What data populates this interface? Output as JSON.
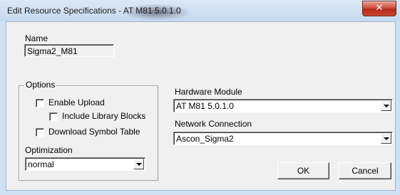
{
  "window": {
    "title": "Edit Resource Specifications - AT M81 5.0.1.0",
    "close_glyph": "✕"
  },
  "name_field": {
    "label": "Name",
    "value": "Sigma2_M81"
  },
  "options": {
    "legend": "Options",
    "enable_upload": {
      "label": "Enable Upload",
      "checked": false
    },
    "include_library_blocks": {
      "label": "Include Library Blocks",
      "checked": false
    },
    "download_symbol_table": {
      "label": "Download Symbol Table",
      "checked": false
    },
    "optimization": {
      "label": "Optimization",
      "value": "normal"
    }
  },
  "hardware_module": {
    "label": "Hardware Module",
    "value": "AT M81 5.0.1.0"
  },
  "network_connection": {
    "label": "Network Connection",
    "value": "Ascon_Sigma2"
  },
  "buttons": {
    "ok": "OK",
    "cancel": "Cancel"
  },
  "colors": {
    "title_bar": "#c6d9ee",
    "client_bg": "#f0f0f0",
    "close_button": "#c8442d"
  },
  "icons": {
    "close": "close-icon",
    "dropdown": "chevron-down-icon"
  }
}
